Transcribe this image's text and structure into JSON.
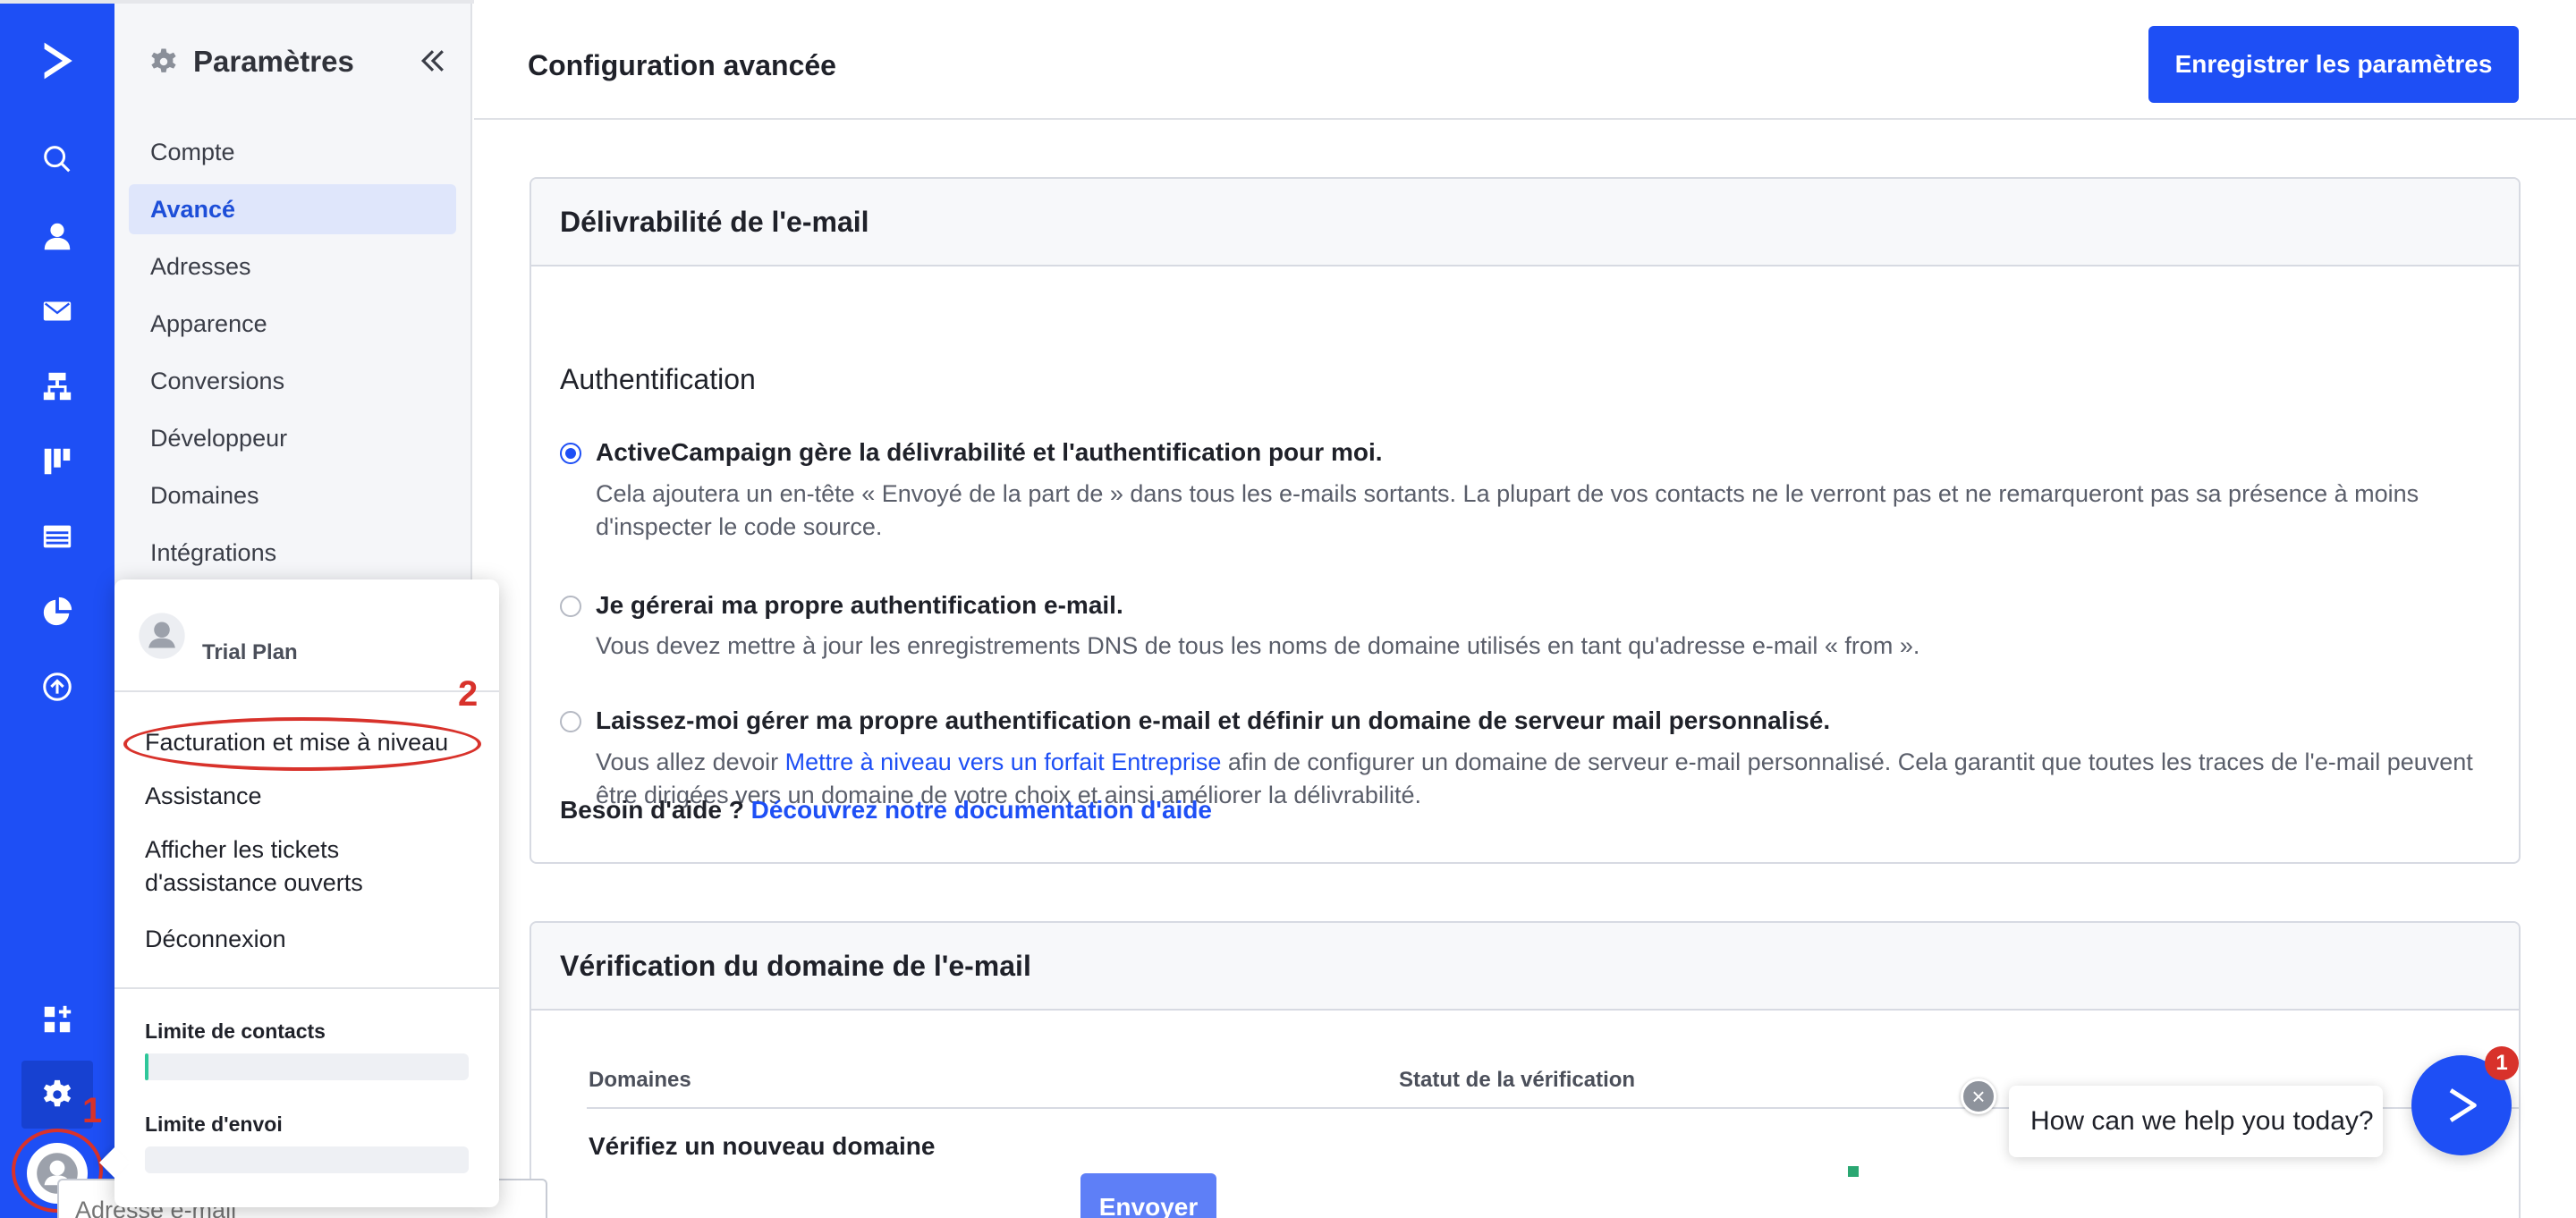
{
  "sidebar": {
    "title": "Paramètres",
    "items": [
      {
        "label": "Compte"
      },
      {
        "label": "Avancé"
      },
      {
        "label": "Adresses"
      },
      {
        "label": "Apparence"
      },
      {
        "label": "Conversions"
      },
      {
        "label": "Développeur"
      },
      {
        "label": "Domaines"
      },
      {
        "label": "Intégrations"
      }
    ]
  },
  "header": {
    "title": "Configuration avancée",
    "save_label": "Enregistrer les paramètres"
  },
  "deliverability": {
    "card_title": "Délivrabilité de l'e-mail",
    "section_title": "Authentification",
    "options": [
      {
        "label": "ActiveCampaign gère la délivrabilité et l'authentification pour moi.",
        "desc": "Cela ajoutera un en-tête « Envoyé de la part de » dans tous les e-mails sortants. La plupart de vos contacts ne le verront pas et ne remarqueront pas sa présence à moins d'inspecter le code source.",
        "selected": true
      },
      {
        "label": "Je gérerai ma propre authentification e-mail.",
        "desc": "Vous devez mettre à jour les enregistrements DNS de tous les noms de domaine utilisés en tant qu'adresse e-mail « from ».",
        "selected": false
      },
      {
        "label": "Laissez-moi gérer ma propre authentification e-mail et définir un domaine de serveur mail personnalisé.",
        "desc_before": "Vous allez devoir ",
        "desc_link": "Mettre à niveau vers un forfait Entreprise",
        "desc_after": " afin de configurer un domaine de serveur e-mail personnalisé. Cela garantit que toutes les traces de l'e-mail peuvent être dirigées vers un domaine de votre choix et ainsi améliorer la délivrabilité.",
        "selected": false
      }
    ],
    "help_prefix": "Besoin d'aide ? ",
    "help_link": "Découvrez notre documentation d'aide"
  },
  "verification": {
    "card_title": "Vérification du domaine de l'e-mail",
    "col_domains": "Domaines",
    "col_status": "Statut de la vérification",
    "verify_label": "Vérifiez un nouveau domaine",
    "email_placeholder": "Adresse e-mail",
    "send_label": "Envoyer"
  },
  "account_menu": {
    "plan": "Trial Plan",
    "items": [
      {
        "label": "Facturation et mise à niveau"
      },
      {
        "label": "Assistance"
      },
      {
        "label": "Afficher les tickets d'assistance ouverts"
      },
      {
        "label": "Déconnexion"
      }
    ],
    "contact_limit_label": "Limite de contacts",
    "contact_limit_fraction": 0.01,
    "send_limit_label": "Limite d'envoi",
    "send_limit_fraction": 0
  },
  "annotations": {
    "marker_1": "1",
    "marker_2": "2"
  },
  "chat": {
    "prompt": "How can we help you today?",
    "badge_count": "1"
  },
  "colors": {
    "brand": "#1e4ff5",
    "annotation_red": "#d8322b"
  }
}
